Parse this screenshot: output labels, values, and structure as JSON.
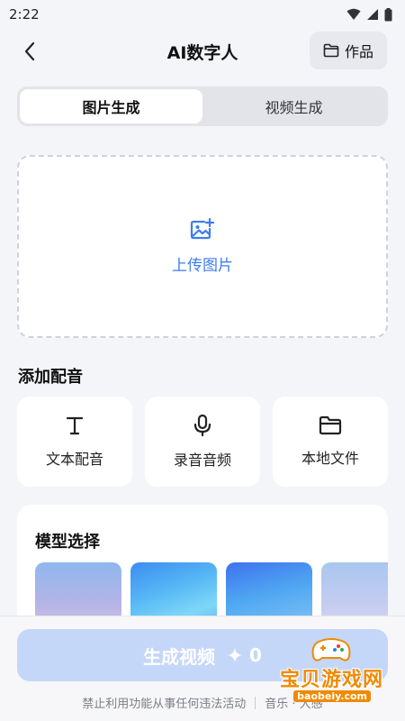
{
  "status_bar": {
    "time": "2:22",
    "icons": [
      "wifi-icon",
      "signal-icon",
      "battery-icon"
    ]
  },
  "header": {
    "title": "AI数字人",
    "works_label": "作品"
  },
  "tabs": [
    {
      "label": "图片生成",
      "active": true
    },
    {
      "label": "视频生成",
      "active": false
    }
  ],
  "upload": {
    "label": "上传图片"
  },
  "audio_section": {
    "title": "添加配音",
    "options": [
      {
        "label": "文本配音",
        "icon": "text-icon"
      },
      {
        "label": "录音音频",
        "icon": "microphone-icon"
      },
      {
        "label": "本地文件",
        "icon": "folder-icon"
      }
    ]
  },
  "model_section": {
    "title": "模型选择"
  },
  "bottom": {
    "generate_label": "生成视频",
    "cost": "0",
    "disclaimer": "禁止利用功能从事任何违法活动",
    "disclaimer_extra": "音乐 · 大感"
  },
  "watermark": {
    "text": "宝贝游戏网",
    "url": "baobeiy.com"
  },
  "colors": {
    "accent": "#3d7df0",
    "generate_disabled": "#c5d7f8",
    "background": "#f4f5f9",
    "watermark": "#f08a00"
  }
}
